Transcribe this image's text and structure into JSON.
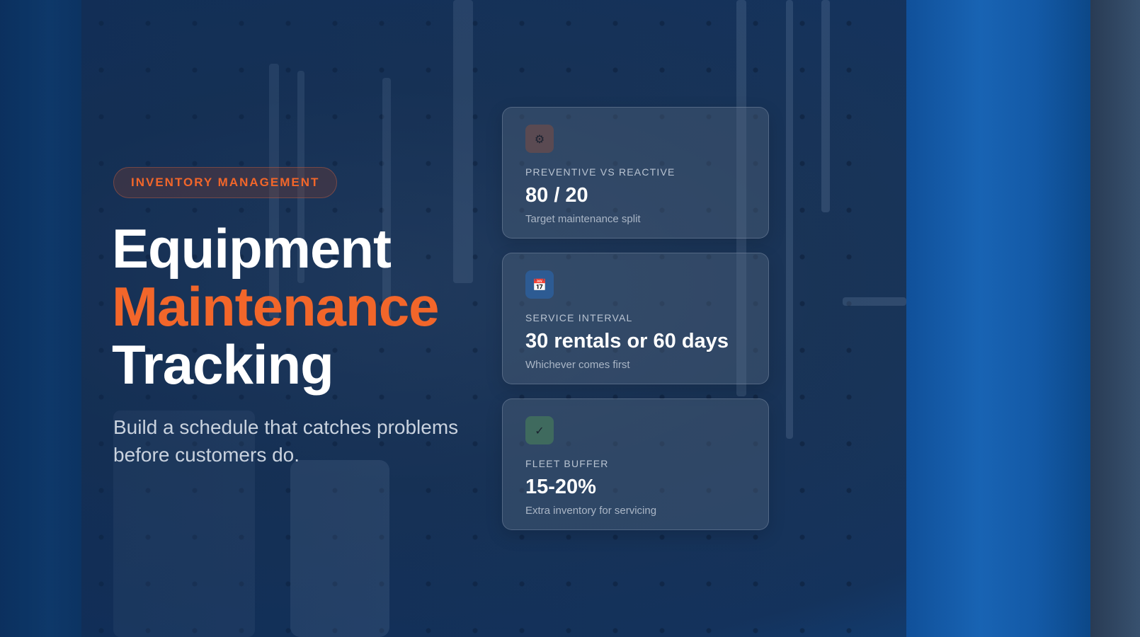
{
  "badge": {
    "label": "INVENTORY MANAGEMENT"
  },
  "hero": {
    "title_line1": "Equipment",
    "title_line2": "Maintenance",
    "title_line3": "Tracking",
    "subtitle": "Build a schedule that catches problems before customers do."
  },
  "cards": [
    {
      "icon": "gear-icon",
      "icon_glyph": "⚙",
      "icon_bg": "#5a4a52",
      "label": "PREVENTIVE VS REACTIVE",
      "value": "80 / 20",
      "description": "Target maintenance split"
    },
    {
      "icon": "calendar-icon",
      "icon_glyph": "📅",
      "icon_bg": "#2d5b93",
      "label": "SERVICE INTERVAL",
      "value": "30 rentals or 60 days",
      "description": "Whichever comes first"
    },
    {
      "icon": "check-icon",
      "icon_glyph": "✓",
      "icon_bg": "#3f6a5e",
      "label": "FLEET BUFFER",
      "value": "15-20%",
      "description": "Extra inventory for servicing"
    }
  ],
  "colors": {
    "accent": "#f2662a",
    "background": "#16355f"
  }
}
